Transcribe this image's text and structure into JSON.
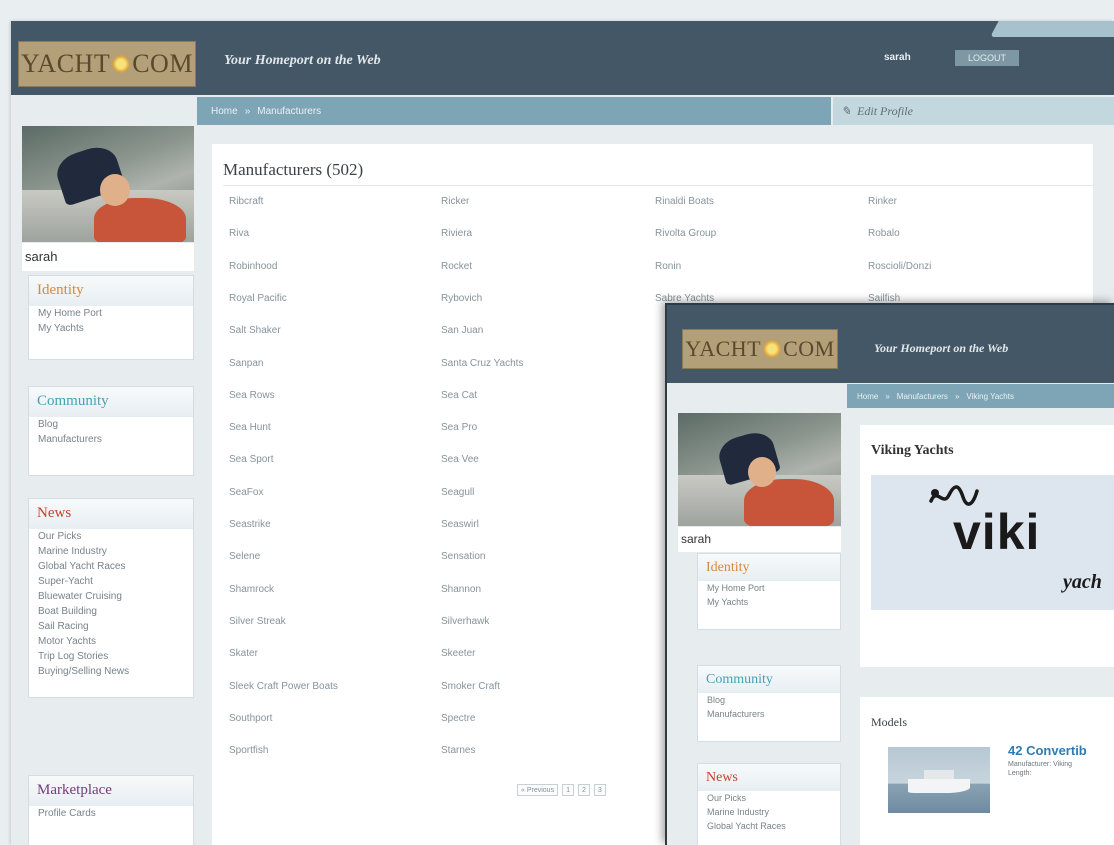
{
  "brand": {
    "logo_left": "YACHT",
    "logo_right": "COM",
    "tagline": "Your Homeport on the Web"
  },
  "user": {
    "name": "sarah",
    "logout_label": "LOGOUT"
  },
  "manufacturers_page": {
    "breadcrumb": [
      "Home",
      "Manufacturers"
    ],
    "edit_profile": "Edit Profile",
    "title": "Manufacturers (502)",
    "columns": [
      [
        "Ribcraft",
        "Riva",
        "Robinhood",
        "Royal Pacific",
        "Salt Shaker",
        "Sanpan",
        "Sea Rows",
        "Sea Hunt",
        "Sea Sport",
        "SeaFox",
        "Seastrike",
        "Selene",
        "Shamrock",
        "Silver Streak",
        "Skater",
        "Sleek Craft Power Boats",
        "Southport",
        "Sportfish"
      ],
      [
        "Ricker",
        "Riviera",
        "Rocket",
        "Rybovich",
        "San Juan",
        "Santa Cruz Yachts",
        "Sea Cat",
        "Sea Pro",
        "Sea Vee",
        "Seagull",
        "Seaswirl",
        "Sensation",
        "Shannon",
        "Silverhawk",
        "Skeeter",
        "Smoker Craft",
        "Spectre",
        "Starnes"
      ],
      [
        "Rinaldi Boats",
        "Rivolta Group",
        "Ronin",
        "Sabre Yachts"
      ],
      [
        "Rinker",
        "Robalo",
        "Roscioli/Donzi",
        "Sailfish"
      ]
    ],
    "pager": [
      "« Previous",
      "1",
      "2",
      "3"
    ],
    "sidebar": [
      {
        "title": "Identity",
        "color": "#d8893a",
        "items": [
          "My Home Port",
          "My Yachts"
        ]
      },
      {
        "title": "Community",
        "color": "#4aa0b4",
        "items": [
          "Blog",
          "Manufacturers"
        ]
      },
      {
        "title": "News",
        "color": "#c8402c",
        "items": [
          "Our Picks",
          "Marine Industry",
          "Global Yacht Races",
          "Super-Yacht",
          "Bluewater Cruising",
          "Boat Building",
          "Sail Racing",
          "Motor Yachts",
          "Trip Log Stories",
          "Buying/Selling News"
        ]
      },
      {
        "title": "Marketplace",
        "color": "#7a3a7a",
        "items": [
          "Profile Cards"
        ]
      }
    ]
  },
  "viking_page": {
    "breadcrumb": [
      "Home",
      "Manufacturers",
      "Viking Yachts"
    ],
    "title": "Viking Yachts",
    "logo_word": "viki",
    "logo_sub": "yach",
    "models_title": "Models",
    "model": {
      "name": "42 Convertib",
      "manufacturer": "Manufacturer: Viking",
      "length": "Length:"
    },
    "sidebar": [
      {
        "title": "Identity",
        "color": "#d8893a",
        "items": [
          "My Home Port",
          "My Yachts"
        ]
      },
      {
        "title": "Community",
        "color": "#4aa0b4",
        "items": [
          "Blog",
          "Manufacturers"
        ]
      },
      {
        "title": "News",
        "color": "#c8402c",
        "items": [
          "Our Picks",
          "Marine Industry",
          "Global Yacht Races"
        ]
      }
    ]
  }
}
